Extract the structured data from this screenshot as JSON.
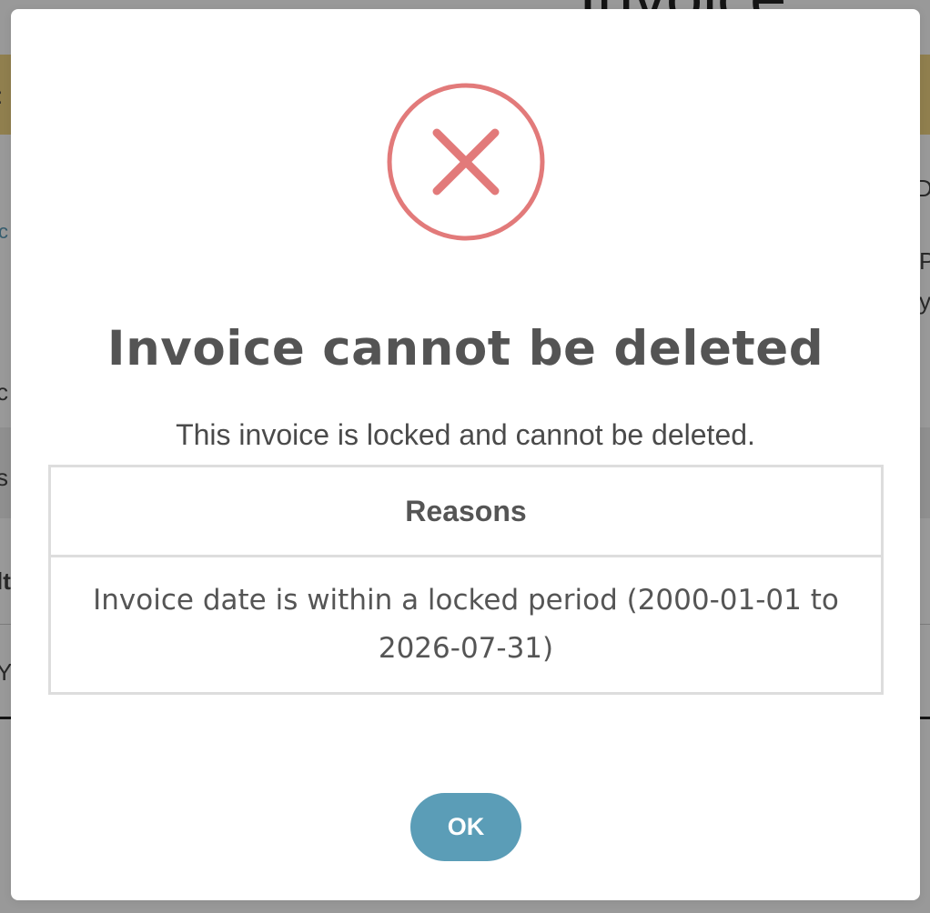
{
  "background_page": {
    "title_fragment": "Invoice",
    "fragments": [
      ":",
      "Da",
      "c",
      "P",
      "y",
      "c",
      "s",
      "lt",
      "Y"
    ]
  },
  "modal": {
    "icon": "error-x-circle-icon",
    "title": "Invoice cannot be deleted",
    "message": "This invoice is locked and cannot be deleted.",
    "table": {
      "header": "Reasons",
      "rows": [
        "Invoice date is within a locked period (2000-01-01 to 2026-07-31)"
      ]
    },
    "ok_label": "OK"
  },
  "colors": {
    "error_red": "#e27a7a",
    "button_blue": "#5b9db7",
    "banner_yellow": "#f0d483",
    "title_gray": "#545454"
  }
}
